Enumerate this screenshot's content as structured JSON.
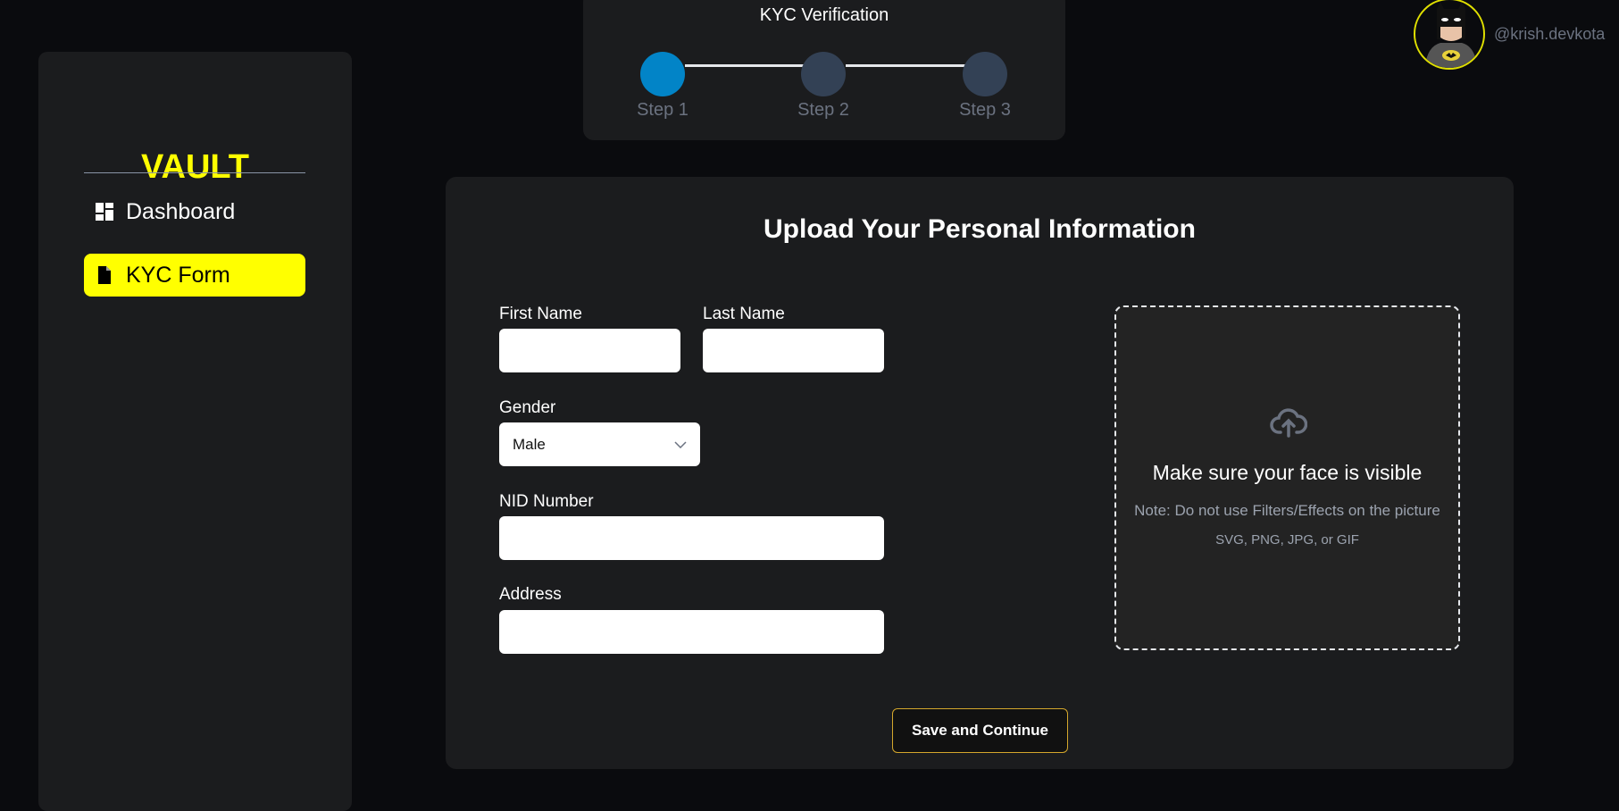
{
  "sidebar": {
    "logo": "VAULT",
    "items": [
      {
        "label": "Dashboard",
        "icon": "dashboard-icon",
        "active": false
      },
      {
        "label": "KYC Form",
        "icon": "file-icon",
        "active": true
      }
    ]
  },
  "stepper": {
    "title": "KYC Verification",
    "steps": [
      {
        "label": "Step 1",
        "active": true
      },
      {
        "label": "Step 2",
        "active": false
      },
      {
        "label": "Step 3",
        "active": false
      }
    ]
  },
  "user": {
    "username": "@krish.devkota",
    "avatar": "batman-avatar"
  },
  "form": {
    "title": "Upload Your Personal Information",
    "first_name": {
      "label": "First Name",
      "value": ""
    },
    "last_name": {
      "label": "Last Name",
      "value": ""
    },
    "gender": {
      "label": "Gender",
      "value": "Male"
    },
    "nid": {
      "label": "NID Number",
      "value": ""
    },
    "address": {
      "label": "Address",
      "value": ""
    },
    "upload": {
      "title": "Make sure your face is visible",
      "note": "Note: Do not use Filters/Effects on the picture",
      "formats": "SVG, PNG, JPG, or GIF"
    },
    "submit_label": "Save and Continue"
  },
  "colors": {
    "accent": "#ffff00",
    "step_active": "#0284c7",
    "step_inactive": "#334155",
    "button_border": "#d4a72c"
  }
}
